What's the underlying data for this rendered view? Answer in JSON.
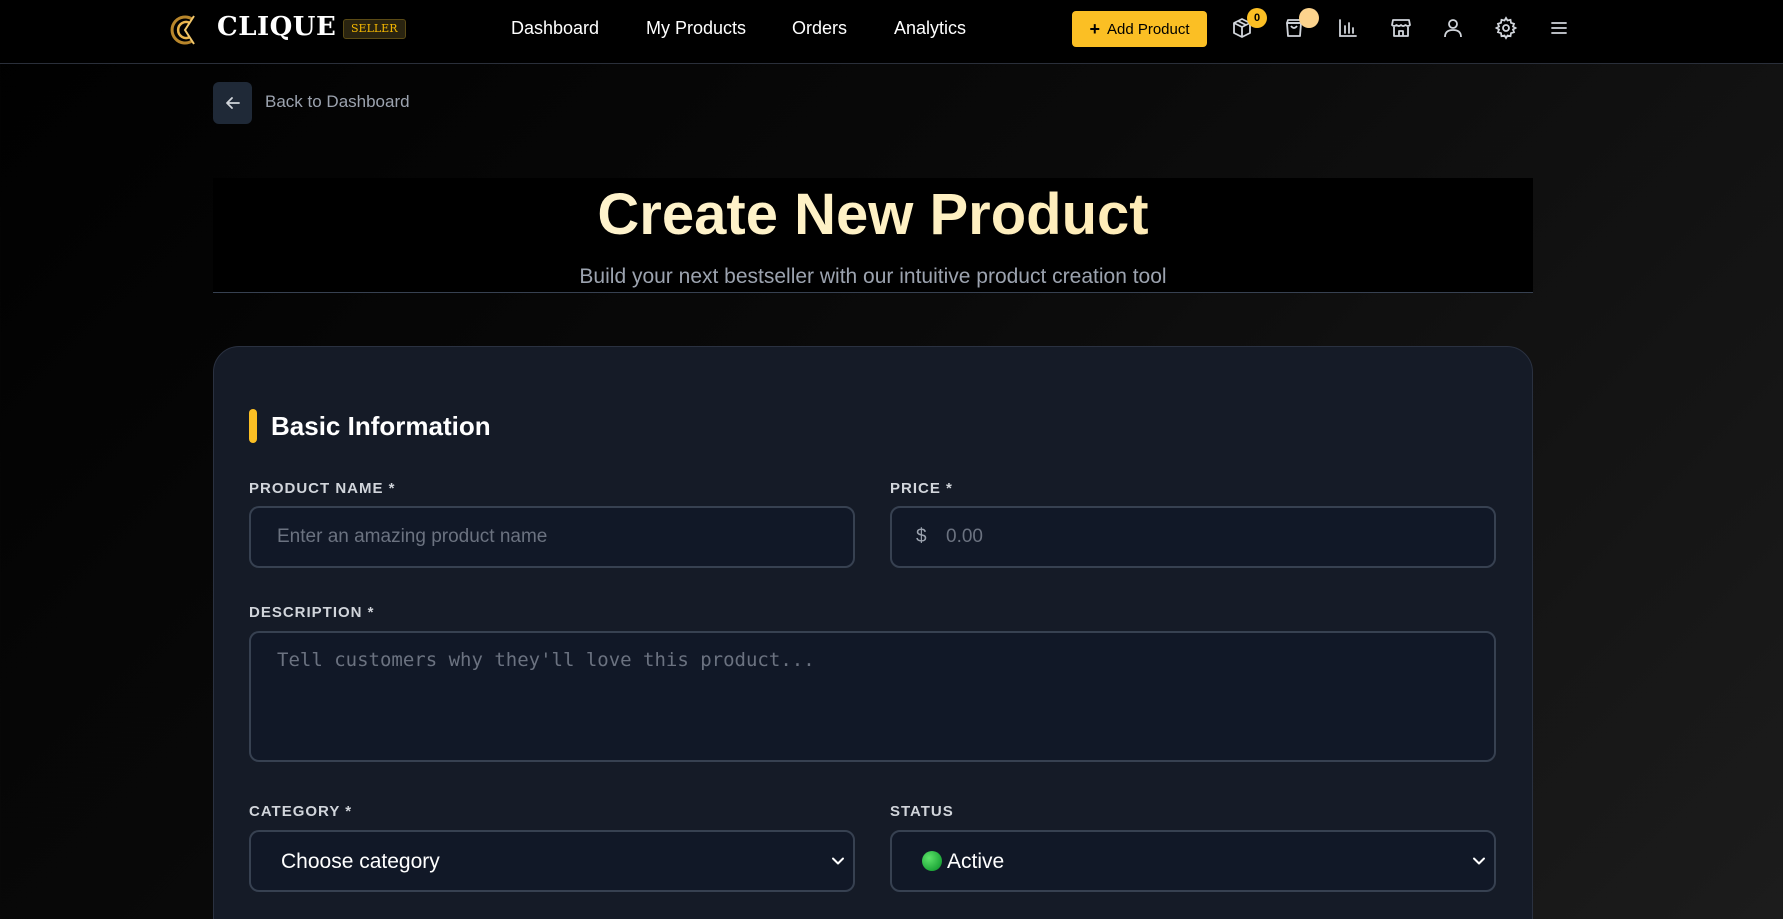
{
  "navbar": {
    "brand": "CLIQUE",
    "badge": "SELLER",
    "links": [
      "Dashboard",
      "My Products",
      "Orders",
      "Analytics"
    ],
    "add_product_label": "Add Product",
    "cart_count": "0",
    "icons": [
      "box-icon",
      "shopping-bag-icon",
      "bar-chart-icon",
      "store-icon",
      "user-icon",
      "settings-icon",
      "menu-icon"
    ],
    "accent_color": "#fbbf24"
  },
  "back": {
    "label": "Back to Dashboard"
  },
  "hero": {
    "title": "Create New Product",
    "subtitle": "Build your next bestseller with our intuitive product creation tool"
  },
  "form": {
    "section_title": "Basic Information",
    "product_name": {
      "label": "PRODUCT NAME *",
      "placeholder": "Enter an amazing product name",
      "value": ""
    },
    "price": {
      "label": "PRICE *",
      "currency": "$",
      "placeholder": "0.00",
      "value": ""
    },
    "description": {
      "label": "DESCRIPTION *",
      "placeholder": "Tell customers why they'll love this product...",
      "value": ""
    },
    "category": {
      "label": "CATEGORY *",
      "selected": "Choose category"
    },
    "status": {
      "label": "STATUS",
      "selected": "Active",
      "status_color": "#22c55e"
    }
  }
}
